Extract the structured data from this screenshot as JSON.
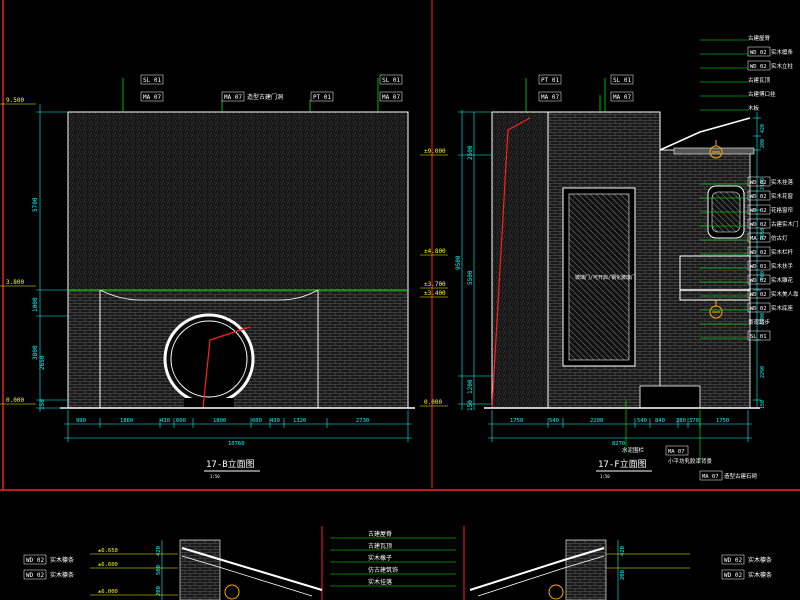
{
  "drawing": {
    "background": "#000000",
    "colors": {
      "wall": "#ffffff",
      "dim": "#00ffff",
      "leader": "#00ff00",
      "tag": "#ffffff",
      "accent": "#ff2020",
      "level": "#ffff00",
      "lantern": "#ffaa00"
    }
  },
  "left_view": {
    "title": "17-B立面图",
    "scale": "1:50",
    "tags": {
      "sl1": "SL 01",
      "ma1": "MA 07",
      "ma_gate": "MA 07",
      "gate_note": "造型古建门洞",
      "pt": "PT 01",
      "sl2": "SL 01",
      "ma2": "MA 07"
    },
    "levels": {
      "top": "9.500",
      "upper": "3.800",
      "ground": "0.000"
    },
    "vert_dims": [
      "5700",
      "1000",
      "3800",
      "2650",
      "150"
    ],
    "horiz_dims": [
      "990",
      "1860",
      "430",
      "600",
      "1800",
      "600",
      "430",
      "1320",
      "2730"
    ],
    "total": "10760"
  },
  "mid_levels": [
    "±9.000",
    "±4.800",
    "±3.700",
    "±3.400",
    "0.000"
  ],
  "right_view": {
    "title": "17-F立面图",
    "scale": "1:50",
    "tags": {
      "pt": "PT 01",
      "sl": "SL 01",
      "ma1": "MA 07",
      "ma2": "MA 07",
      "ma3": "MA 07"
    },
    "glass_note": "玻璃门/可开启/钢化玻璃门",
    "vert_dims": [
      "2500",
      "9500",
      "5500",
      "1200",
      "150"
    ],
    "horiz_dims": [
      "1750",
      "540",
      "2200",
      "540",
      "840",
      "280",
      "370",
      "1750"
    ],
    "total": "8270",
    "bottom_notes": {
      "n1": "水泥围栏",
      "n1tag": "MA 07",
      "n2": "小平坊乳胶漆背景",
      "n3": "造型古建石砌",
      "n3tag": "MA 07"
    },
    "right_dims": [
      "420",
      "200",
      "2100",
      "2050",
      "900",
      "1900",
      "2290",
      "150"
    ],
    "annotations": [
      {
        "text": "古建屋脊",
        "tag": ""
      },
      {
        "text": "实木檩条",
        "tag": "WD 02"
      },
      {
        "text": "实木立柱",
        "tag": "WD 02"
      },
      {
        "text": "古建瓦顶",
        "tag": ""
      },
      {
        "text": "古建博口挂",
        "tag": ""
      },
      {
        "text": "木板",
        "tag": ""
      },
      {
        "text": "实木挂落",
        "tag": "WD 02"
      },
      {
        "text": "实木花窗",
        "tag": "WD 02"
      },
      {
        "text": "花格窗帘",
        "tag": "WD 02"
      },
      {
        "text": "古建实木门",
        "tag": "WD 02"
      },
      {
        "text": "仿古灯",
        "tag": "MA 07"
      },
      {
        "text": "实木栏杆",
        "tag": "WD 02"
      },
      {
        "text": "实木扶手",
        "tag": "WD 01"
      },
      {
        "text": "实木雕花",
        "tag": "WD 02"
      },
      {
        "text": "实木美人靠",
        "tag": "WD 02"
      },
      {
        "text": "实木底座",
        "tag": "WD 02"
      },
      {
        "text": "景观踏步",
        "tag": ""
      },
      {
        "text": "",
        "tag": "SL 01"
      }
    ]
  },
  "bottom_detail": {
    "left_tags": [
      "WD 02",
      "WD 02"
    ],
    "left_notes": [
      "实木檩条",
      "实木檩条"
    ],
    "right_tags": [
      "WD 02",
      "WD 02"
    ],
    "right_notes": [
      "实木檩条",
      "实木檩条"
    ],
    "center_notes": [
      "古建屋脊",
      "古建瓦顶",
      "实木橡子",
      "仿古建筑饰",
      "实木挂落"
    ],
    "dims_left": [
      "420",
      "500",
      "200"
    ],
    "dims_right": [
      "420",
      "200"
    ],
    "levels": [
      "±6.650",
      "±6.600",
      "±6.000"
    ]
  }
}
